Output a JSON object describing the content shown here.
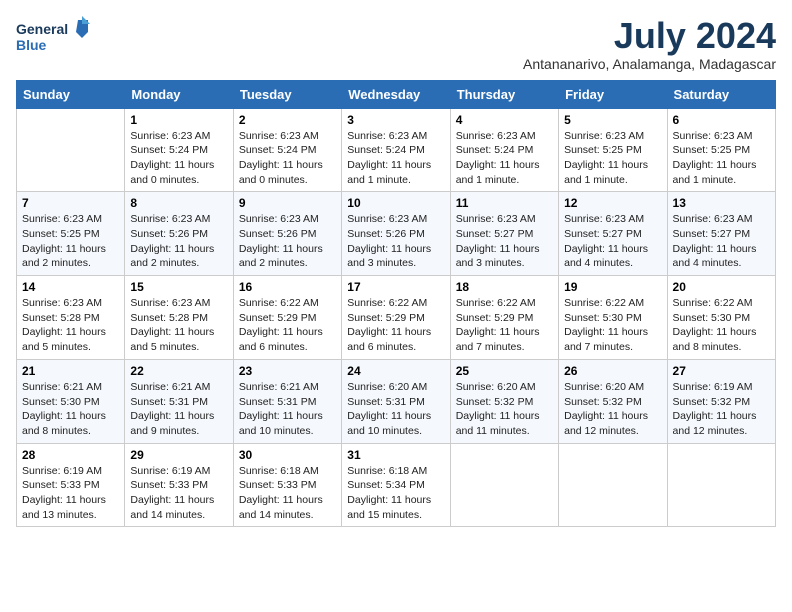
{
  "header": {
    "logo_line1": "General",
    "logo_line2": "Blue",
    "month_year": "July 2024",
    "location": "Antananarivo, Analamanga, Madagascar"
  },
  "days_of_week": [
    "Sunday",
    "Monday",
    "Tuesday",
    "Wednesday",
    "Thursday",
    "Friday",
    "Saturday"
  ],
  "weeks": [
    [
      {
        "day": "",
        "info": ""
      },
      {
        "day": "1",
        "info": "Sunrise: 6:23 AM\nSunset: 5:24 PM\nDaylight: 11 hours\nand 0 minutes."
      },
      {
        "day": "2",
        "info": "Sunrise: 6:23 AM\nSunset: 5:24 PM\nDaylight: 11 hours\nand 0 minutes."
      },
      {
        "day": "3",
        "info": "Sunrise: 6:23 AM\nSunset: 5:24 PM\nDaylight: 11 hours\nand 1 minute."
      },
      {
        "day": "4",
        "info": "Sunrise: 6:23 AM\nSunset: 5:24 PM\nDaylight: 11 hours\nand 1 minute."
      },
      {
        "day": "5",
        "info": "Sunrise: 6:23 AM\nSunset: 5:25 PM\nDaylight: 11 hours\nand 1 minute."
      },
      {
        "day": "6",
        "info": "Sunrise: 6:23 AM\nSunset: 5:25 PM\nDaylight: 11 hours\nand 1 minute."
      }
    ],
    [
      {
        "day": "7",
        "info": "Sunrise: 6:23 AM\nSunset: 5:25 PM\nDaylight: 11 hours\nand 2 minutes."
      },
      {
        "day": "8",
        "info": "Sunrise: 6:23 AM\nSunset: 5:26 PM\nDaylight: 11 hours\nand 2 minutes."
      },
      {
        "day": "9",
        "info": "Sunrise: 6:23 AM\nSunset: 5:26 PM\nDaylight: 11 hours\nand 2 minutes."
      },
      {
        "day": "10",
        "info": "Sunrise: 6:23 AM\nSunset: 5:26 PM\nDaylight: 11 hours\nand 3 minutes."
      },
      {
        "day": "11",
        "info": "Sunrise: 6:23 AM\nSunset: 5:27 PM\nDaylight: 11 hours\nand 3 minutes."
      },
      {
        "day": "12",
        "info": "Sunrise: 6:23 AM\nSunset: 5:27 PM\nDaylight: 11 hours\nand 4 minutes."
      },
      {
        "day": "13",
        "info": "Sunrise: 6:23 AM\nSunset: 5:27 PM\nDaylight: 11 hours\nand 4 minutes."
      }
    ],
    [
      {
        "day": "14",
        "info": "Sunrise: 6:23 AM\nSunset: 5:28 PM\nDaylight: 11 hours\nand 5 minutes."
      },
      {
        "day": "15",
        "info": "Sunrise: 6:23 AM\nSunset: 5:28 PM\nDaylight: 11 hours\nand 5 minutes."
      },
      {
        "day": "16",
        "info": "Sunrise: 6:22 AM\nSunset: 5:29 PM\nDaylight: 11 hours\nand 6 minutes."
      },
      {
        "day": "17",
        "info": "Sunrise: 6:22 AM\nSunset: 5:29 PM\nDaylight: 11 hours\nand 6 minutes."
      },
      {
        "day": "18",
        "info": "Sunrise: 6:22 AM\nSunset: 5:29 PM\nDaylight: 11 hours\nand 7 minutes."
      },
      {
        "day": "19",
        "info": "Sunrise: 6:22 AM\nSunset: 5:30 PM\nDaylight: 11 hours\nand 7 minutes."
      },
      {
        "day": "20",
        "info": "Sunrise: 6:22 AM\nSunset: 5:30 PM\nDaylight: 11 hours\nand 8 minutes."
      }
    ],
    [
      {
        "day": "21",
        "info": "Sunrise: 6:21 AM\nSunset: 5:30 PM\nDaylight: 11 hours\nand 8 minutes."
      },
      {
        "day": "22",
        "info": "Sunrise: 6:21 AM\nSunset: 5:31 PM\nDaylight: 11 hours\nand 9 minutes."
      },
      {
        "day": "23",
        "info": "Sunrise: 6:21 AM\nSunset: 5:31 PM\nDaylight: 11 hours\nand 10 minutes."
      },
      {
        "day": "24",
        "info": "Sunrise: 6:20 AM\nSunset: 5:31 PM\nDaylight: 11 hours\nand 10 minutes."
      },
      {
        "day": "25",
        "info": "Sunrise: 6:20 AM\nSunset: 5:32 PM\nDaylight: 11 hours\nand 11 minutes."
      },
      {
        "day": "26",
        "info": "Sunrise: 6:20 AM\nSunset: 5:32 PM\nDaylight: 11 hours\nand 12 minutes."
      },
      {
        "day": "27",
        "info": "Sunrise: 6:19 AM\nSunset: 5:32 PM\nDaylight: 11 hours\nand 12 minutes."
      }
    ],
    [
      {
        "day": "28",
        "info": "Sunrise: 6:19 AM\nSunset: 5:33 PM\nDaylight: 11 hours\nand 13 minutes."
      },
      {
        "day": "29",
        "info": "Sunrise: 6:19 AM\nSunset: 5:33 PM\nDaylight: 11 hours\nand 14 minutes."
      },
      {
        "day": "30",
        "info": "Sunrise: 6:18 AM\nSunset: 5:33 PM\nDaylight: 11 hours\nand 14 minutes."
      },
      {
        "day": "31",
        "info": "Sunrise: 6:18 AM\nSunset: 5:34 PM\nDaylight: 11 hours\nand 15 minutes."
      },
      {
        "day": "",
        "info": ""
      },
      {
        "day": "",
        "info": ""
      },
      {
        "day": "",
        "info": ""
      }
    ]
  ]
}
